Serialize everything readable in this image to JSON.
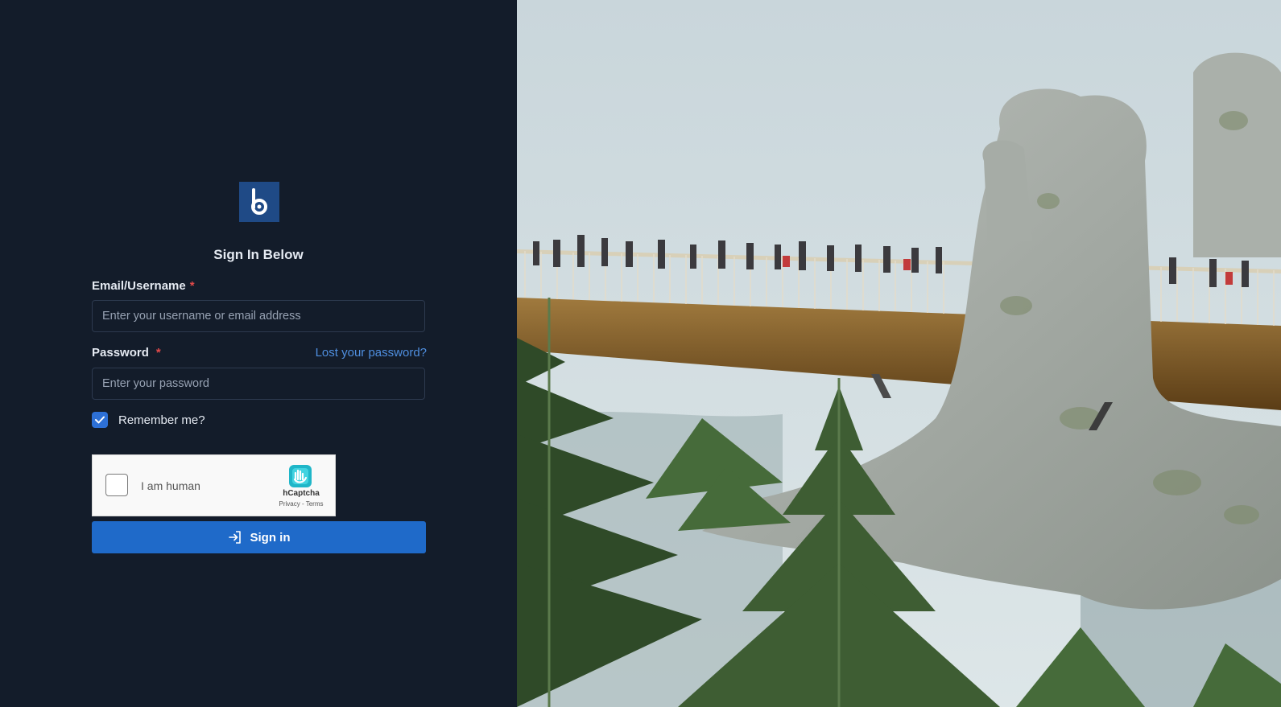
{
  "form": {
    "title": "Sign In Below",
    "email_label": "Email/Username",
    "email_placeholder": "Enter your username or email address",
    "password_label": "Password",
    "password_placeholder": "Enter your password",
    "required_marker": "*",
    "lost_password": "Lost your password?",
    "remember_label": "Remember me?",
    "remember_checked": true,
    "signin_label": "Sign in"
  },
  "captcha": {
    "label": "I am human",
    "brand": "hCaptcha",
    "links": "Privacy - Terms"
  },
  "colors": {
    "background": "#131c2a",
    "accent": "#1f6ac9",
    "logo_bg": "#1f4a86",
    "link": "#4f8fe0",
    "required": "#e34a4a"
  },
  "icons": {
    "logo": "brand-logo-icon",
    "checkbox": "checkmark-icon",
    "signin": "sign-in-icon",
    "captcha": "hcaptcha-logo-icon"
  }
}
